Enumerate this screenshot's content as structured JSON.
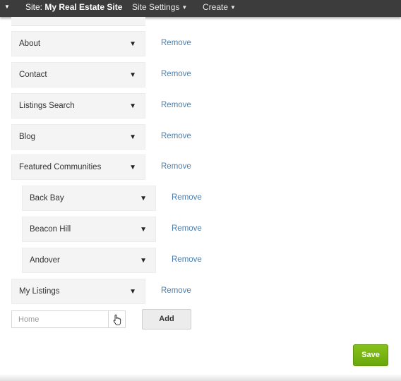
{
  "topbar": {
    "site_prefix": "Site:",
    "site_name": "My Real Estate Site",
    "site_settings": "Site Settings",
    "create": "Create"
  },
  "menu": {
    "items": [
      {
        "label": "About",
        "remove": "Remove"
      },
      {
        "label": "Contact",
        "remove": "Remove"
      },
      {
        "label": "Listings Search",
        "remove": "Remove"
      },
      {
        "label": "Blog",
        "remove": "Remove"
      },
      {
        "label": "Featured Communities",
        "remove": "Remove"
      },
      {
        "label": "Back Bay",
        "remove": "Remove"
      },
      {
        "label": "Beacon Hill",
        "remove": "Remove"
      },
      {
        "label": "Andover",
        "remove": "Remove"
      },
      {
        "label": "My Listings",
        "remove": "Remove"
      }
    ]
  },
  "add_form": {
    "placeholder": "Home",
    "add_label": "Add"
  },
  "save_label": "Save",
  "colors": {
    "topbar": "#3c3c3c",
    "link": "#4a7fb0",
    "save": "#77b414"
  }
}
